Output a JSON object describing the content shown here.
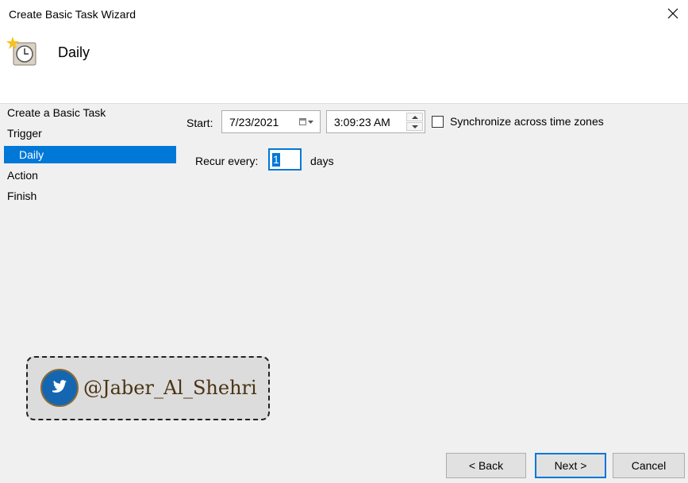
{
  "window": {
    "title": "Create Basic Task Wizard"
  },
  "header": {
    "heading": "Daily"
  },
  "steps": [
    {
      "label": "Create a Basic Task"
    },
    {
      "label": "Trigger"
    },
    {
      "label": "Daily"
    },
    {
      "label": "Action"
    },
    {
      "label": "Finish"
    }
  ],
  "active_step": "Daily",
  "form": {
    "start_label": "Start:",
    "start_date": "7/23/2021",
    "start_time": "3:09:23 AM",
    "sync_label": "Synchronize across time zones",
    "sync_checked": false,
    "recur_label": "Recur every:",
    "recur_value": "1",
    "recur_unit": "days"
  },
  "buttons": {
    "back": "< Back",
    "next": "Next >",
    "cancel": "Cancel"
  },
  "watermark": {
    "handle": "@Jaber_Al_Shehri"
  },
  "colors": {
    "accent": "#0078d7",
    "background": "#f0f0f0",
    "twitter_badge": "#1466b1"
  }
}
